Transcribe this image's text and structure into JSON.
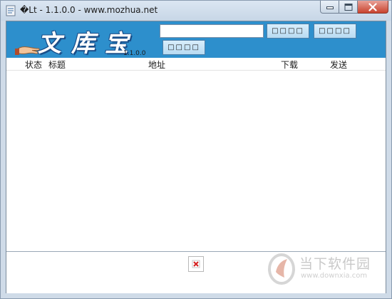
{
  "window": {
    "title": "�Lt - 1.1.0.0 - www.mozhua.net"
  },
  "banner": {
    "logo_text": [
      "文",
      "库",
      "宝"
    ],
    "version": "1.1.0.0",
    "search": {
      "value": "",
      "placeholder": ""
    },
    "buttons": [
      "□□□□",
      "□□□□",
      "□□□□"
    ]
  },
  "list": {
    "columns": [
      "状态",
      "标题",
      "地址",
      "下载",
      "发送"
    ],
    "rows": []
  },
  "watermark": {
    "title": "当下软件园",
    "url": "www.downxia.com"
  },
  "colors": {
    "banner": "#2d8fcc",
    "button_fill": "#c8e4f6",
    "close_button": "#c8432e"
  },
  "icons": [
    "app-icon",
    "minimize-icon",
    "maximize-icon",
    "close-icon",
    "hand-icon",
    "broken-image-icon",
    "watermark-logo-icon"
  ]
}
